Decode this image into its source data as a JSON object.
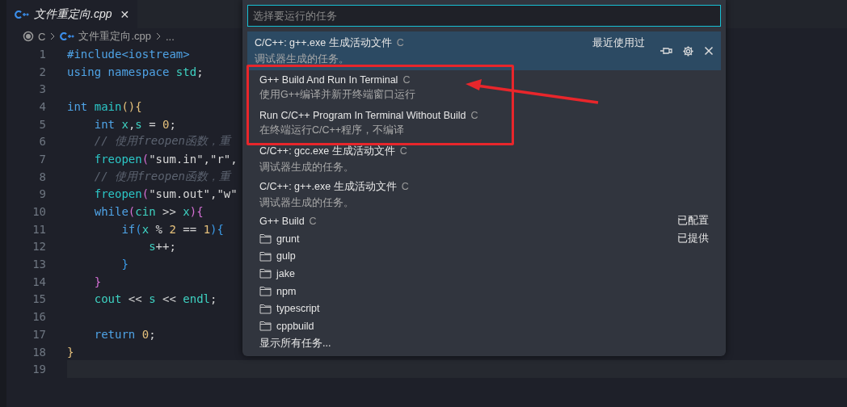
{
  "tab": {
    "label": "文件重定向.cpp",
    "close": "✕"
  },
  "breadcrumb": [
    "C",
    "文件重定向.cpp",
    "..."
  ],
  "code": [
    {
      "n": "1",
      "tokens": [
        {
          "t": "#include<iostream>",
          "kind": "keyword"
        }
      ]
    },
    {
      "n": "2",
      "tokens": [
        {
          "t": "using namespace ",
          "kind": "keyword"
        },
        {
          "t": "std",
          "kind": "variable"
        },
        {
          "t": ";",
          "kind": "plain"
        }
      ]
    },
    {
      "n": "3"
    },
    {
      "n": "4",
      "tokens": [
        {
          "t": "int ",
          "kind": "keyword"
        },
        {
          "t": "main",
          "kind": "function"
        },
        {
          "t": "(){",
          "kind": "bracket1"
        }
      ]
    },
    {
      "n": "5",
      "tokens": [
        {
          "t": "    int ",
          "kind": "keyword"
        },
        {
          "t": "x",
          "kind": "variable"
        },
        {
          "t": ",",
          "kind": "plain"
        },
        {
          "t": "s",
          "kind": "variable"
        },
        {
          "t": " = ",
          "kind": "plain"
        },
        {
          "t": "0",
          "kind": "number"
        },
        {
          "t": ";",
          "kind": "plain"
        }
      ]
    },
    {
      "n": "6",
      "tokens": [
        {
          "t": "    // 使用freopen函数，重",
          "kind": "comment"
        }
      ]
    },
    {
      "n": "7",
      "tokens": [
        {
          "t": "    freopen",
          "kind": "function"
        },
        {
          "t": "(",
          "kind": "bracket2"
        },
        {
          "t": "\"sum.in\",\"r\",",
          "kind": "string"
        }
      ]
    },
    {
      "n": "8",
      "tokens": [
        {
          "t": "    // 使用freopen函数，重",
          "kind": "comment"
        }
      ]
    },
    {
      "n": "9",
      "tokens": [
        {
          "t": "    freopen",
          "kind": "function"
        },
        {
          "t": "(",
          "kind": "bracket2"
        },
        {
          "t": "\"sum.out\",\"w\"",
          "kind": "string"
        }
      ]
    },
    {
      "n": "10",
      "tokens": [
        {
          "t": "    while",
          "kind": "keyword"
        },
        {
          "t": "(",
          "kind": "bracket2"
        },
        {
          "t": "cin",
          "kind": "variable"
        },
        {
          "t": " >> ",
          "kind": "plain"
        },
        {
          "t": "x",
          "kind": "variable"
        },
        {
          "t": "){",
          "kind": "bracket2"
        }
      ]
    },
    {
      "n": "11",
      "tokens": [
        {
          "t": "        if",
          "kind": "keyword"
        },
        {
          "t": "(",
          "kind": "bracket3"
        },
        {
          "t": "x",
          "kind": "variable"
        },
        {
          "t": " % ",
          "kind": "plain"
        },
        {
          "t": "2",
          "kind": "number"
        },
        {
          "t": " == ",
          "kind": "plain"
        },
        {
          "t": "1",
          "kind": "number"
        },
        {
          "t": "){",
          "kind": "bracket3"
        }
      ]
    },
    {
      "n": "12",
      "tokens": [
        {
          "t": "            s",
          "kind": "variable"
        },
        {
          "t": "++;",
          "kind": "plain"
        }
      ]
    },
    {
      "n": "13",
      "tokens": [
        {
          "t": "        }",
          "kind": "bracket3"
        }
      ]
    },
    {
      "n": "14",
      "tokens": [
        {
          "t": "    }",
          "kind": "bracket2"
        }
      ]
    },
    {
      "n": "15",
      "tokens": [
        {
          "t": "    cout",
          "kind": "variable"
        },
        {
          "t": " << ",
          "kind": "plain"
        },
        {
          "t": "s",
          "kind": "variable"
        },
        {
          "t": " << ",
          "kind": "plain"
        },
        {
          "t": "endl",
          "kind": "variable"
        },
        {
          "t": ";",
          "kind": "plain"
        }
      ]
    },
    {
      "n": "16"
    },
    {
      "n": "17",
      "tokens": [
        {
          "t": "    return ",
          "kind": "keyword"
        },
        {
          "t": "0",
          "kind": "number"
        },
        {
          "t": ";",
          "kind": "plain"
        }
      ]
    },
    {
      "n": "18",
      "tokens": [
        {
          "t": "}",
          "kind": "bracket1"
        }
      ]
    },
    {
      "n": "19",
      "current": true
    }
  ],
  "quick_pick": {
    "placeholder": "选择要运行的任务",
    "items": [
      {
        "kind": "task",
        "label": "C/C++: g++.exe 生成活动文件",
        "badge": "C",
        "detail": "调试器生成的任务。",
        "right": "最近使用过",
        "selected": true
      },
      {
        "kind": "task",
        "label": "G++ Build And Run In Terminal",
        "badge": "C",
        "detail": "使用G++编译并新开终端窗口运行",
        "selected": false
      },
      {
        "kind": "task",
        "label": "Run C/C++ Program In Terminal Without Build",
        "badge": "C",
        "detail": "在终端运行C/C++程序，不编译",
        "selected": false
      },
      {
        "kind": "task",
        "label": "C/C++: gcc.exe 生成活动文件",
        "badge": "C",
        "detail": "调试器生成的任务。",
        "selected": false
      },
      {
        "kind": "task",
        "label": "C/C++: g++.exe 生成活动文件",
        "badge": "C",
        "detail": "调试器生成的任务。",
        "selected": false
      },
      {
        "kind": "task",
        "label": "G++ Build",
        "badge": "C",
        "right": "已配置",
        "selected": false
      },
      {
        "kind": "folder",
        "label": "grunt",
        "right": "已提供",
        "selected": false
      },
      {
        "kind": "folder",
        "label": "gulp",
        "selected": false
      },
      {
        "kind": "folder",
        "label": "jake",
        "selected": false
      },
      {
        "kind": "folder",
        "label": "npm",
        "selected": false
      },
      {
        "kind": "folder",
        "label": "typescript",
        "selected": false
      },
      {
        "kind": "folder",
        "label": "cppbuild",
        "selected": false
      },
      {
        "kind": "more",
        "label": "显示所有任务...",
        "selected": false
      }
    ]
  }
}
